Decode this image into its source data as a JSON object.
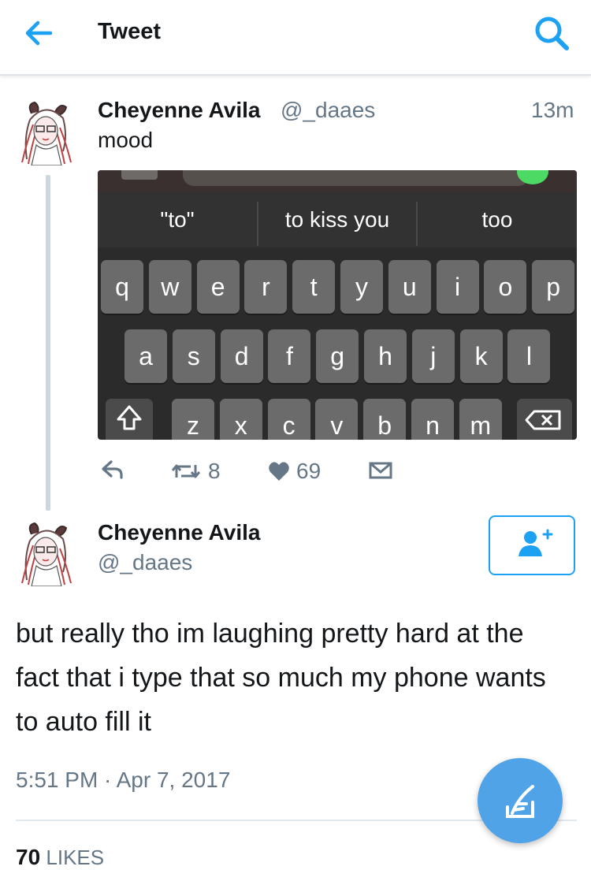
{
  "header": {
    "title": "Tweet",
    "back_icon": "arrow-left-icon",
    "search_icon": "search-icon",
    "accent": "#1da1f2"
  },
  "reply_tweet": {
    "name": "Cheyenne Avila",
    "handle": "@_daaes",
    "time_ago": "13m",
    "text": "mood",
    "media": {
      "suggestions": [
        "\"to\"",
        "to kiss you",
        "too"
      ],
      "row1": [
        "q",
        "w",
        "e",
        "r",
        "t",
        "y",
        "u",
        "i",
        "o",
        "p"
      ],
      "row2": [
        "a",
        "s",
        "d",
        "f",
        "g",
        "h",
        "j",
        "k",
        "l"
      ],
      "row3": [
        "z",
        "x",
        "c",
        "v",
        "b",
        "n",
        "m"
      ]
    },
    "actions": {
      "retweets": "8",
      "likes": "69"
    }
  },
  "main_tweet": {
    "name": "Cheyenne Avila",
    "handle": "@_daaes",
    "text": "but really tho im laughing pretty hard at the fact that i type that so much my phone wants to auto fill it",
    "timestamp": "5:51 PM · Apr 7, 2017",
    "likes_count": "70",
    "likes_label": "LIKES"
  },
  "compose_icon": "compose-tweet-icon"
}
